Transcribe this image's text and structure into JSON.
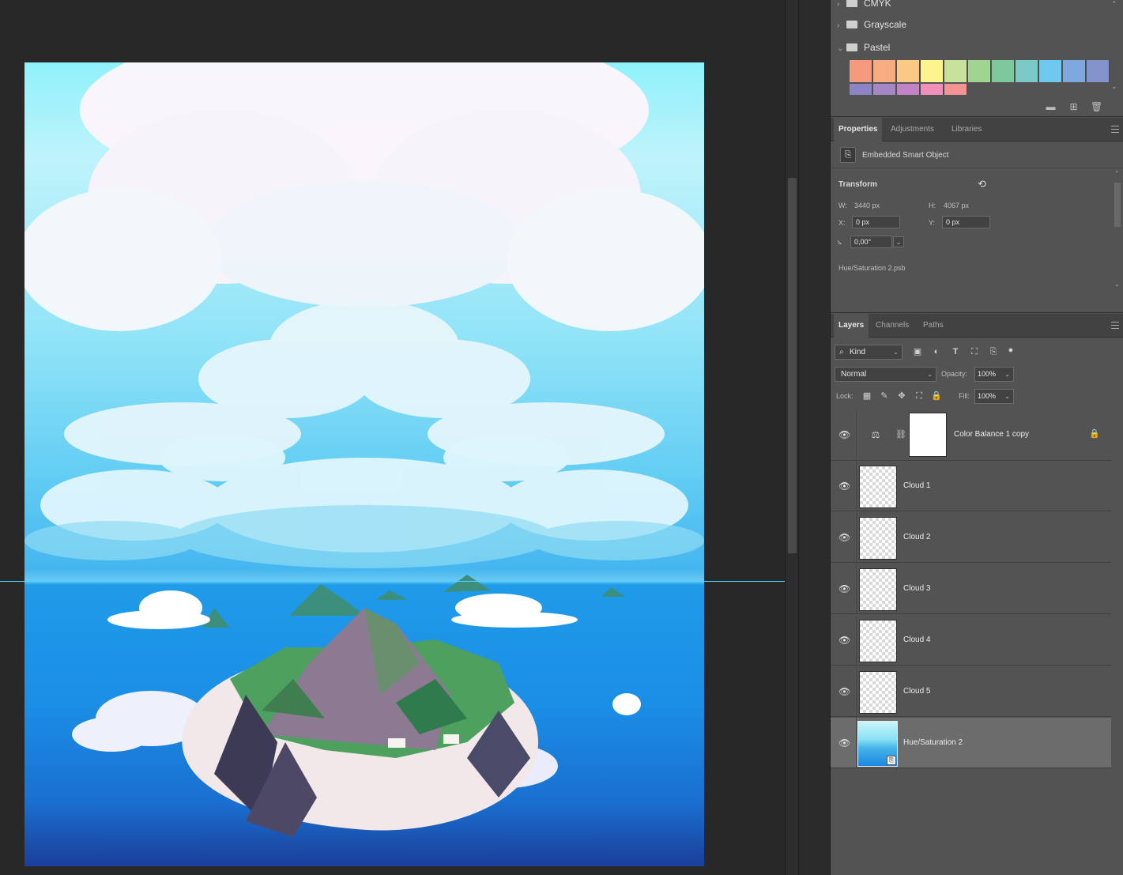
{
  "swatches": {
    "groups": [
      {
        "name": "CMYK",
        "expanded": false
      },
      {
        "name": "Grayscale",
        "expanded": false
      },
      {
        "name": "Pastel",
        "expanded": true
      }
    ],
    "pastel_colors_row1": [
      "#f49a7d",
      "#f8ad80",
      "#fcc985",
      "#fdf48e",
      "#c8e19b",
      "#a0d591",
      "#7dc89c",
      "#7ccac7",
      "#6ec8ef",
      "#7ea9df",
      "#8493cc"
    ],
    "pastel_colors_row2": [
      "#8c84c4",
      "#a487c4",
      "#c384c5",
      "#f18fbb",
      "#f49393"
    ]
  },
  "properties": {
    "tabs": [
      "Properties",
      "Adjustments",
      "Libraries"
    ],
    "active_tab": "Properties",
    "object_type": "Embedded Smart Object",
    "transform_label": "Transform",
    "w_label": "W:",
    "w_value": "3440 px",
    "h_label": "H:",
    "h_value": "4067 px",
    "x_label": "X:",
    "x_value": "0 px",
    "y_label": "Y:",
    "y_value": "0 px",
    "angle_value": "0,00°",
    "file_name": "Hue/Saturation 2.psb"
  },
  "layers_panel": {
    "tabs": [
      "Layers",
      "Channels",
      "Paths"
    ],
    "active_tab": "Layers",
    "filter_kind": "Kind",
    "blend_mode": "Normal",
    "opacity_label": "Opacity:",
    "opacity_value": "100%",
    "lock_label": "Lock:",
    "fill_label": "Fill:",
    "fill_value": "100%",
    "layers": [
      {
        "name": "Color Balance 1 copy",
        "type": "adjustment",
        "locked": true,
        "visible": true,
        "selected": false
      },
      {
        "name": "Cloud 1",
        "type": "pixel",
        "visible": true,
        "selected": false
      },
      {
        "name": "Cloud 2",
        "type": "pixel",
        "visible": true,
        "selected": false
      },
      {
        "name": "Cloud 3",
        "type": "pixel",
        "visible": true,
        "selected": false
      },
      {
        "name": "Cloud 4",
        "type": "pixel",
        "visible": true,
        "selected": false
      },
      {
        "name": "Cloud 5",
        "type": "pixel",
        "visible": true,
        "selected": false
      },
      {
        "name": "Hue/Saturation 2",
        "type": "smart-object",
        "visible": true,
        "selected": true
      }
    ]
  },
  "colors": {
    "panel_bg": "#535353",
    "tab_bar_bg": "#424242",
    "workspace_bg": "#282828",
    "guide": "#4fd6ff",
    "selected_layer": "#6c6c6c"
  }
}
